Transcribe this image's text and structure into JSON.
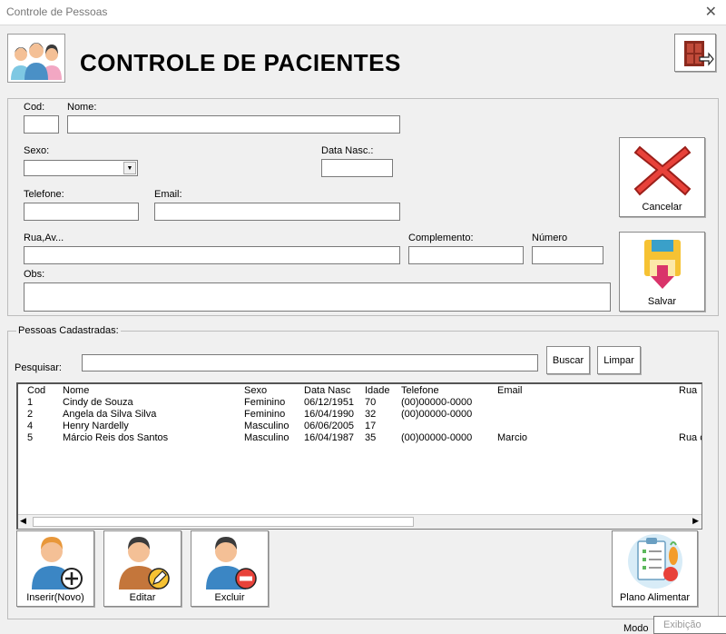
{
  "window": {
    "title": "Controle de Pessoas",
    "close_glyph": "✕"
  },
  "header": {
    "title": "CONTROLE DE PACIENTES",
    "logo_icon": "people-group-icon",
    "exit_icon": "exit-door-icon"
  },
  "form": {
    "cod_label": "Cod:",
    "nome_label": "Nome:",
    "sexo_label": "Sexo:",
    "data_nasc_label": "Data Nasc.:",
    "telefone_label": "Telefone:",
    "email_label": "Email:",
    "rua_label": "Rua,Av...",
    "complemento_label": "Complemento:",
    "numero_label": "Número",
    "obs_label": "Obs:",
    "dropdown_glyph": "▼"
  },
  "actions": {
    "cancel_label": "Cancelar",
    "save_label": "Salvar"
  },
  "people": {
    "legend": "Pessoas Cadastradas:",
    "search_label": "Pesquisar:",
    "search_button": "Buscar",
    "clear_button": "Limpar",
    "columns": [
      "Cod",
      "Nome",
      "Sexo",
      "Data Nasc",
      "Idade",
      "Telefone",
      "Email",
      "Rua"
    ],
    "rows": [
      [
        "1",
        "Cindy de Souza",
        "Feminino",
        "06/12/1951",
        "70",
        "(00)00000-0000",
        "",
        ""
      ],
      [
        "2",
        "Angela da Silva Silva",
        "Feminino",
        "16/04/1990",
        "32",
        "(00)00000-0000",
        "",
        ""
      ],
      [
        "4",
        "Henry Nardelly",
        "Masculino",
        "06/06/2005",
        "17",
        "",
        "",
        ""
      ],
      [
        "5",
        "Márcio Reis dos Santos",
        "Masculino",
        "16/04/1987",
        "35",
        "(00)00000-0000",
        "Marcio",
        "Rua c"
      ]
    ],
    "scroll_left": "◀",
    "scroll_right": "▶"
  },
  "bottom": {
    "insert_label": "Inserir(Novo)",
    "edit_label": "Editar",
    "delete_label": "Excluir",
    "diet_label": "Plano Alimentar",
    "mode_label": "Modo",
    "mode_value": "Exibição"
  },
  "colors": {
    "cancel_red": "#e8423a",
    "save_yellow": "#f6c233",
    "save_pink": "#d9346a",
    "skin": "#f4c096",
    "hair": "#3b3b3b"
  }
}
